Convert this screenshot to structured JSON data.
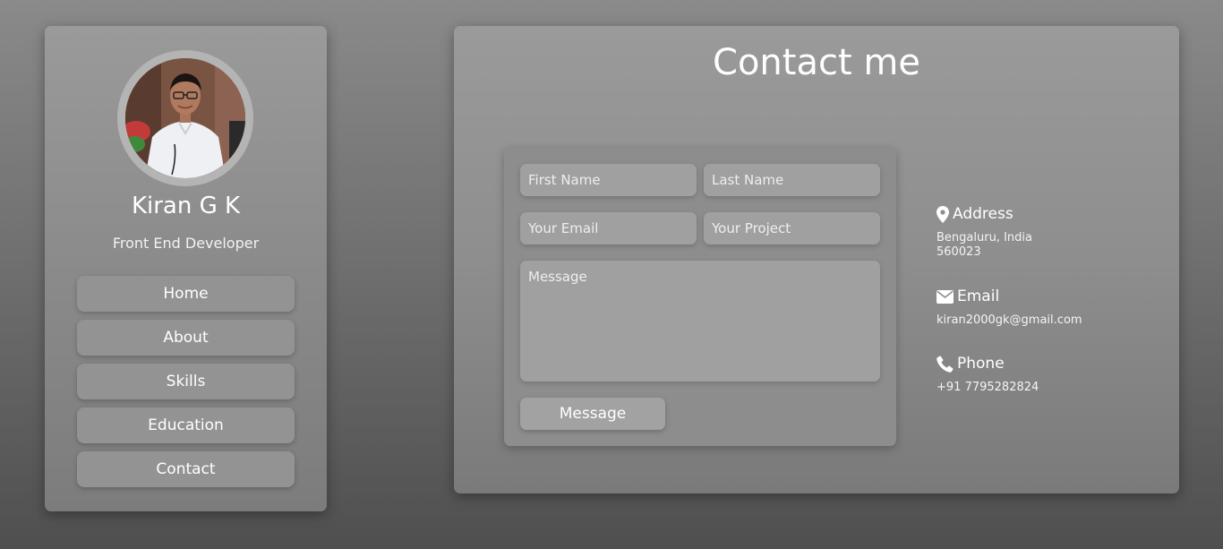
{
  "profile": {
    "name": "Kiran G K",
    "role": "Front End Developer",
    "avatar_icon": "profile-photo"
  },
  "nav": {
    "items": [
      {
        "label": "Home"
      },
      {
        "label": "About"
      },
      {
        "label": "Skills"
      },
      {
        "label": "Education"
      },
      {
        "label": "Contact"
      }
    ]
  },
  "contact": {
    "title": "Contact me",
    "form": {
      "first_name_placeholder": "First Name",
      "last_name_placeholder": "Last Name",
      "email_placeholder": "Your Email",
      "project_placeholder": "Your Project",
      "message_placeholder": "Message",
      "submit_label": "Message"
    },
    "info": {
      "address": {
        "icon": "map-marker-icon",
        "heading": "Address",
        "line1": "Bengaluru, India",
        "line2": "560023"
      },
      "email": {
        "icon": "envelope-icon",
        "heading": "Email",
        "value": "kiran2000gk@gmail.com"
      },
      "phone": {
        "icon": "phone-icon",
        "heading": "Phone",
        "value": "+91 7795282824"
      }
    }
  },
  "colors": {
    "page_top": "#8a8a8a",
    "page_bottom": "#4f4f4f",
    "card": "#8e8e8e",
    "button": "#939393",
    "field": "#a0a0a0",
    "text": "#ffffff"
  }
}
